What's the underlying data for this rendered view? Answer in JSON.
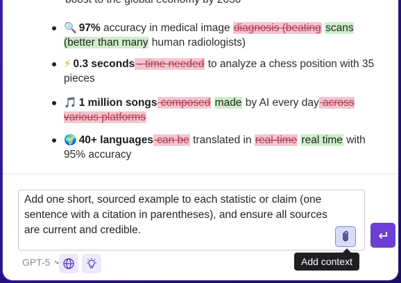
{
  "document": {
    "cut_top_line": "boost to the global economy by 2030",
    "bullets": [
      {
        "icon": "magnifier-icon",
        "glyph": "🔍",
        "bold": "97%",
        "segments": [
          {
            "type": "normal",
            "text": " accuracy in medical image "
          },
          {
            "type": "del",
            "text": "diagnosis (beating"
          },
          {
            "type": "normal",
            "text": " "
          },
          {
            "type": "ins",
            "text": "scans (better than many"
          },
          {
            "type": "normal",
            "text": " human radiologists)"
          }
        ]
      },
      {
        "icon": "lightning-icon",
        "glyph": "⚡",
        "bold": "0.3 seconds",
        "segments": [
          {
            "type": "del",
            "text": " - time needed"
          },
          {
            "type": "normal",
            "text": " to analyze a chess position with 35 pieces"
          }
        ]
      },
      {
        "icon": "music-note-icon",
        "glyph": "🎵",
        "bold": "1 million songs",
        "segments": [
          {
            "type": "del",
            "text": " composed"
          },
          {
            "type": "normal",
            "text": " "
          },
          {
            "type": "ins",
            "text": "made"
          },
          {
            "type": "normal",
            "text": " by AI every day"
          },
          {
            "type": "del",
            "text": " across various platforms"
          }
        ]
      },
      {
        "icon": "globe-icon",
        "glyph": "🌍",
        "bold": "40+ languages",
        "segments": [
          {
            "type": "del",
            "text": " can be"
          },
          {
            "type": "normal",
            "text": " translated in "
          },
          {
            "type": "del",
            "text": "real-time"
          },
          {
            "type": "normal",
            "text": " "
          },
          {
            "type": "ins",
            "text": "real time"
          },
          {
            "type": "normal",
            "text": " with 95% accuracy"
          }
        ]
      }
    ]
  },
  "composer": {
    "text": "Add one short, sourced example to each statistic or claim (one sentence with a citation in parentheses), and ensure all sources are current and credible.",
    "attach_tooltip": "Add context"
  },
  "toolbar": {
    "model_label": "GPT-5"
  },
  "colors": {
    "accent": "#6d3fd6",
    "deletion_bg": "#f3c6cf",
    "insertion_bg": "#cdeec9"
  }
}
